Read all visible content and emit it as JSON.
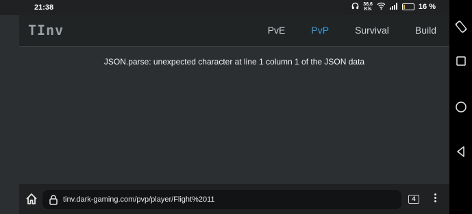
{
  "status": {
    "time": "21:38",
    "speed_value": "36.6",
    "speed_unit": "K/s",
    "battery_percent": "16 %",
    "battery_level": 0.16
  },
  "header": {
    "logo": "TInv",
    "nav": [
      {
        "label": "PvE",
        "active": false
      },
      {
        "label": "PvP",
        "active": true
      },
      {
        "label": "Survival",
        "active": false
      },
      {
        "label": "Build",
        "active": false
      }
    ]
  },
  "main": {
    "error": "JSON.parse: unexpected character at line 1 column 1 of the JSON data"
  },
  "browser": {
    "url": "tinv.dark-gaming.com/pvp/player/Flight%2011",
    "tab_count": "4"
  },
  "icons": {
    "home": "home-icon",
    "lock": "lock-icon",
    "menu": "more-vert-icon",
    "rotate": "rotate-icon",
    "recents": "square-icon",
    "home_nav": "circle-icon",
    "back": "triangle-back-icon"
  }
}
